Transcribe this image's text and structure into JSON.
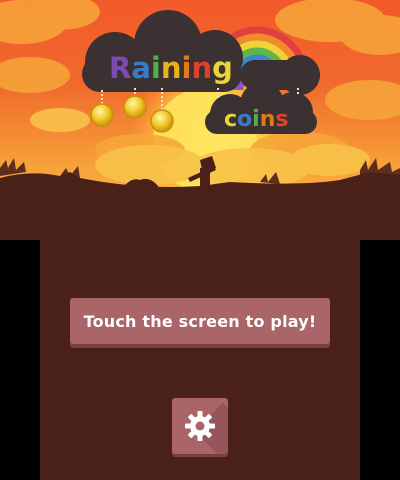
{
  "title": {
    "word1_letters": [
      {
        "ch": "R",
        "color": "#7b4bb0"
      },
      {
        "ch": "a",
        "color": "#3a79c8"
      },
      {
        "ch": "i",
        "color": "#4fb04a"
      },
      {
        "ch": "n",
        "color": "#e8b21f"
      },
      {
        "ch": "i",
        "color": "#e07a1a"
      },
      {
        "ch": "n",
        "color": "#d9442a"
      },
      {
        "ch": "g",
        "color": "#e9d53a"
      }
    ],
    "word2_letters": [
      {
        "ch": "c",
        "color": "#e9d53a"
      },
      {
        "ch": "o",
        "color": "#3a79c8"
      },
      {
        "ch": "i",
        "color": "#4fb04a"
      },
      {
        "ch": "n",
        "color": "#e07a1a"
      },
      {
        "ch": "s",
        "color": "#d9442a"
      }
    ]
  },
  "menu": {
    "play_label": "Touch the screen to play!"
  },
  "icons": {
    "settings": "gear-icon"
  },
  "colors": {
    "button": "#a96568",
    "bottom_bg": "#4a201a",
    "ground": "#4a2119"
  }
}
